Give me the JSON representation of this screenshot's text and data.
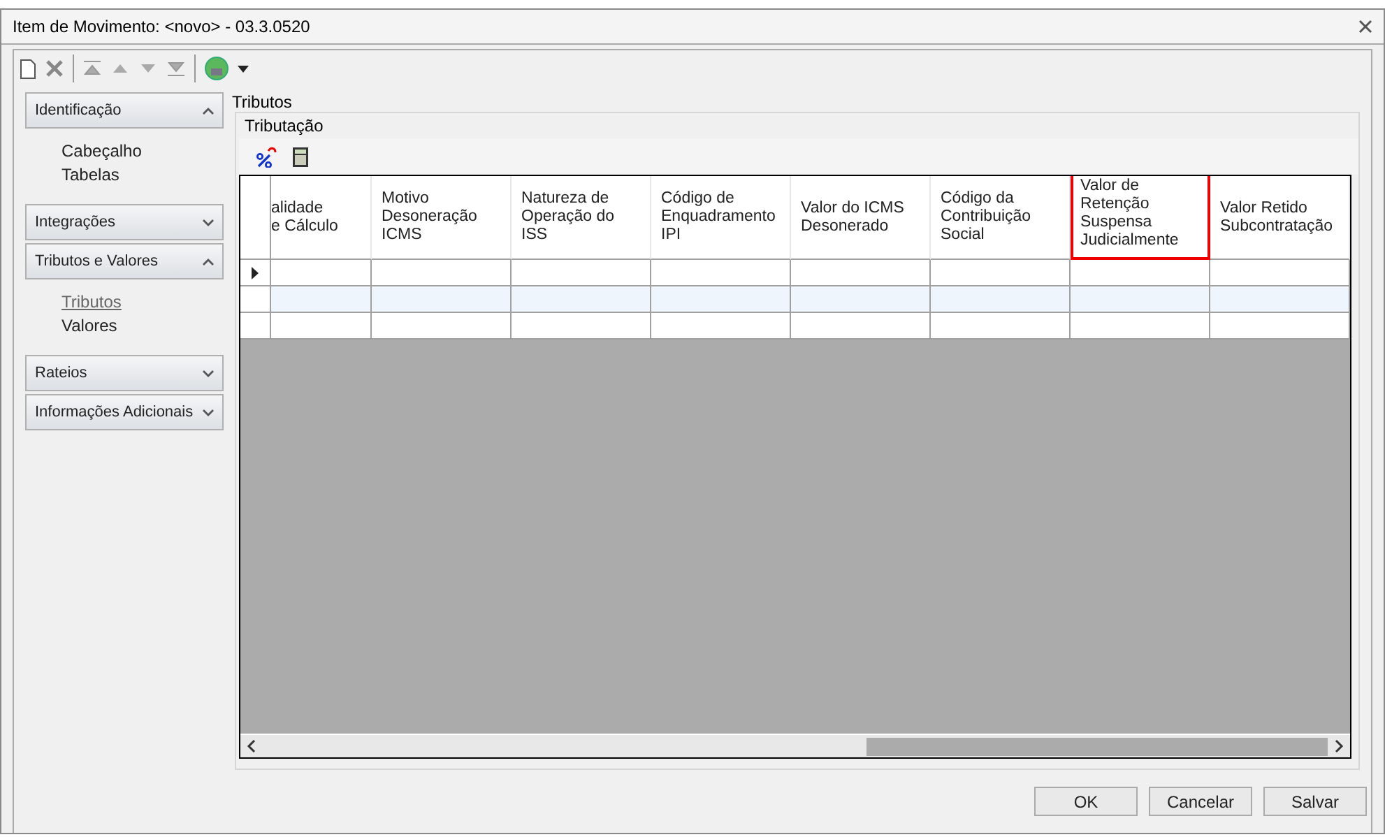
{
  "window": {
    "title": "Item de Movimento: <novo> - 03.3.0520"
  },
  "sidebar": {
    "groups": [
      {
        "label": "Identificação",
        "expanded": true,
        "items": [
          {
            "label": "Cabeçalho",
            "selected": false
          },
          {
            "label": "Tabelas",
            "selected": false
          }
        ]
      },
      {
        "label": "Integrações",
        "expanded": false
      },
      {
        "label": "Tributos e Valores",
        "expanded": true,
        "items": [
          {
            "label": "Tributos",
            "selected": true
          },
          {
            "label": "Valores",
            "selected": false
          }
        ]
      },
      {
        "label": "Rateios",
        "expanded": false
      },
      {
        "label": "Informações Adicionais",
        "expanded": false
      }
    ]
  },
  "section_title": "Tributos",
  "group_title": "Tributação",
  "table": {
    "columns": [
      {
        "label": "alidade\ne Cálculo",
        "highlighted": false
      },
      {
        "label": "Motivo\nDesoneração\nICMS",
        "highlighted": false
      },
      {
        "label": "Natureza de\nOperação do\nISS",
        "highlighted": false
      },
      {
        "label": "Código de\nEnquadramento\nIPI",
        "highlighted": false
      },
      {
        "label": "Valor do ICMS\nDesonerado",
        "highlighted": false
      },
      {
        "label": "Código da\nContribuição\nSocial",
        "highlighted": false
      },
      {
        "label": "Valor de\nRetenção\nSuspensa\nJudicialmente",
        "highlighted": true
      },
      {
        "label": "Valor Retido\nSubcontratação",
        "highlighted": false
      }
    ],
    "rows": [
      {
        "current": true
      },
      {
        "current": false
      },
      {
        "current": false
      }
    ]
  },
  "buttons": [
    "OK",
    "Cancelar",
    "Salvar"
  ]
}
